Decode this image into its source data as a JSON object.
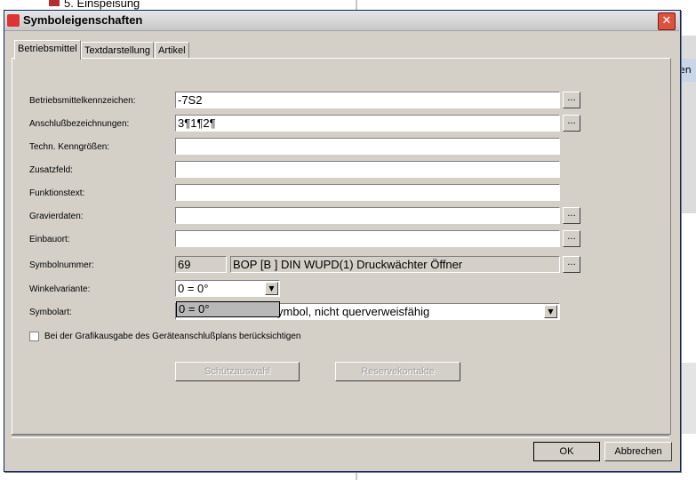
{
  "background": {
    "tree_item": "5. Einspeisung",
    "right_edge_text": "en"
  },
  "dialog": {
    "title": "Symboleigenschaften",
    "close_glyph": "✕"
  },
  "tabs": [
    {
      "label": "Betriebsmittel",
      "active": true
    },
    {
      "label": "Textdarstellung",
      "active": false
    },
    {
      "label": "Artikel",
      "active": false
    }
  ],
  "fields": {
    "betriebsmittelkennzeichen": {
      "label": "Betriebsmittelkennzeichen:",
      "value": "-7S2"
    },
    "anschluss": {
      "label": "Anschlußbezeichnungen:",
      "value": "3¶1¶2¶"
    },
    "kenngroessen": {
      "label": "Techn. Kenngrößen:",
      "value": ""
    },
    "zusatzfeld": {
      "label": "Zusatzfeld:",
      "value": ""
    },
    "funktionstext": {
      "label": "Funktionstext:",
      "value": ""
    },
    "gravierdaten": {
      "label": "Gravierdaten:",
      "value": ""
    },
    "einbauort": {
      "label": "Einbauort:",
      "value": ""
    },
    "symbolnummer": {
      "label": "Symbolnummer:",
      "number": "69",
      "description": "BOP [B  ] DIN  WUPD(1) Druckwächter Öffner"
    },
    "winkelvariante": {
      "label": "Winkelvariante:",
      "value": "0 = 0°",
      "open_option": "0 = 0°"
    },
    "symbolart": {
      "label": "Symbolart:",
      "value": "ymbol, nicht querverweisfähig"
    }
  },
  "dots_label": "...",
  "checkbox": {
    "label": "Bei der Grafikausgabe des Geräteanschlußplans berücksichtigen",
    "checked": false
  },
  "buttons": {
    "schuetz": "Schützauswahl",
    "reserve": "Reservekontakte",
    "ok": "OK",
    "cancel": "Abbrechen"
  }
}
